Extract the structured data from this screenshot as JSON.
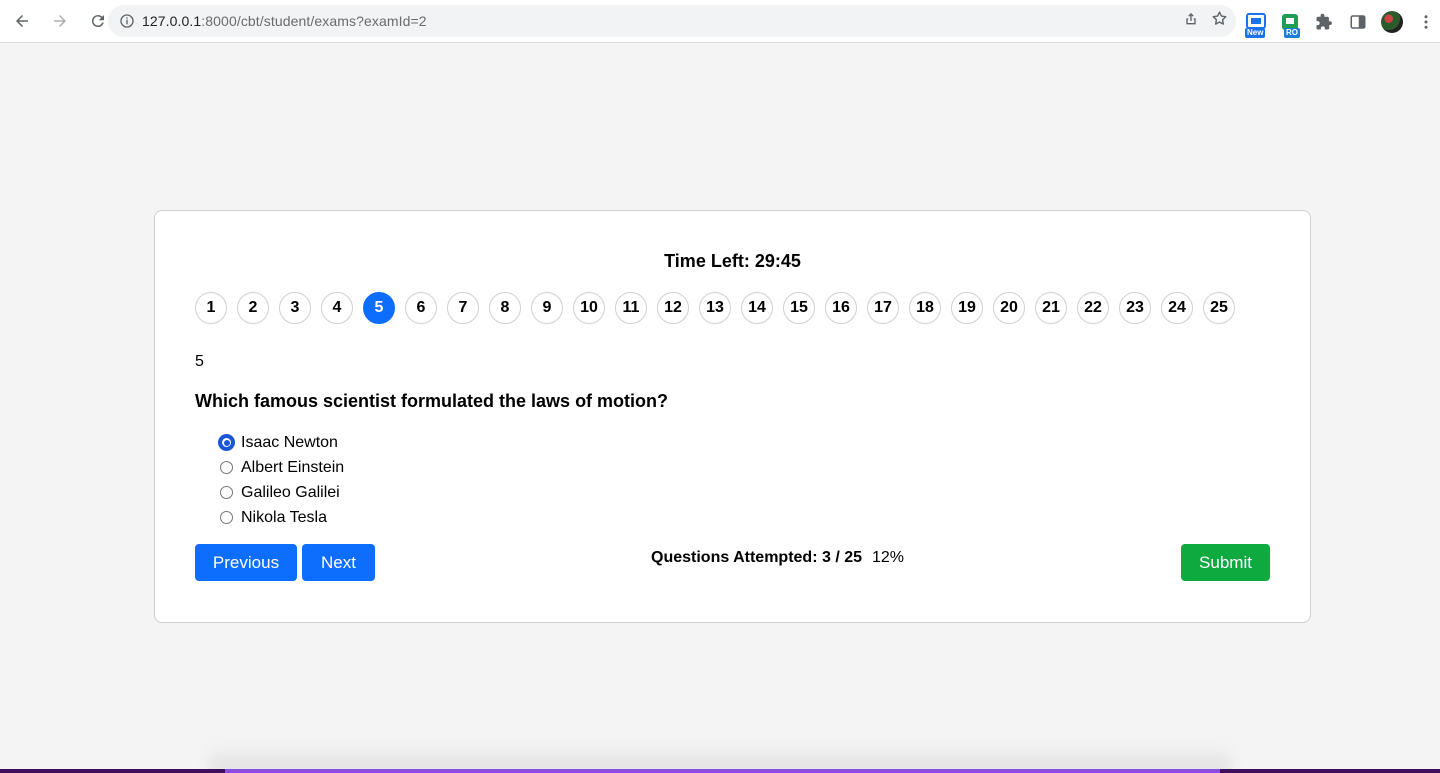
{
  "browser": {
    "url_host": "127.0.0.1",
    "url_rest": ":8000/cbt/student/exams?examId=2",
    "extensions": [
      {
        "icon": "screencast-extension-icon",
        "badge": "New"
      },
      {
        "icon": "green-extension-icon",
        "badge": "RO"
      }
    ]
  },
  "exam": {
    "timer_label": "Time Left: 29:45",
    "questions": [
      "1",
      "2",
      "3",
      "4",
      "5",
      "6",
      "7",
      "8",
      "9",
      "10",
      "11",
      "12",
      "13",
      "14",
      "15",
      "16",
      "17",
      "18",
      "19",
      "20",
      "21",
      "22",
      "23",
      "24",
      "25"
    ],
    "active_question": "5",
    "current_number": "5",
    "question_text": "Which famous scientist formulated the laws of motion?",
    "options": [
      {
        "label": "Isaac Newton",
        "checked": true
      },
      {
        "label": "Albert Einstein",
        "checked": false
      },
      {
        "label": "Galileo Galilei",
        "checked": false
      },
      {
        "label": "Nikola Tesla",
        "checked": false
      }
    ],
    "previous_label": "Previous",
    "next_label": "Next",
    "submit_label": "Submit",
    "attempted_label": "Questions Attempted: 3 / 25",
    "percent_label": "12%"
  },
  "colors": {
    "primary": "#0d6efd",
    "success": "#0eaa40"
  }
}
